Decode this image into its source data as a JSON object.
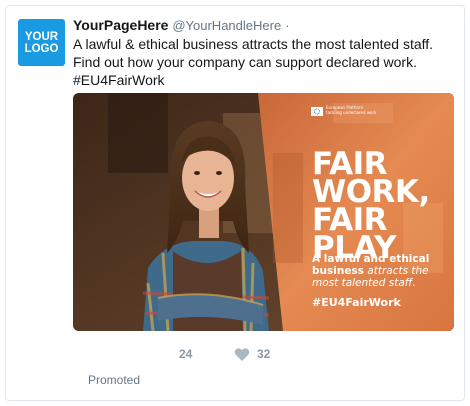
{
  "logo": {
    "text": "YOUR\nLOGO",
    "bg": "#1a9ae0"
  },
  "header": {
    "page_name": "YourPageHere",
    "handle": "@YourHandleHere",
    "separator": "·"
  },
  "tweet": {
    "text": "A lawful & ethical business attracts the most talented staff. Find out how your company can support declared work. #EU4FairWork"
  },
  "media": {
    "eu_label": "European Platform\ntackling undeclared work",
    "headline": [
      "FAIR",
      "WORK,",
      "FAIR",
      "PLAY"
    ],
    "sub_bold": "A lawful and ethical business",
    "sub_italic": " attracts the most talented staff.",
    "hashtag": "#EU4FairWork",
    "accent": "#e07a3e"
  },
  "actions": {
    "reply_count": "24",
    "like_count": "32",
    "icons": [
      "heart-icon"
    ]
  },
  "footer": {
    "promoted": "Promoted"
  }
}
